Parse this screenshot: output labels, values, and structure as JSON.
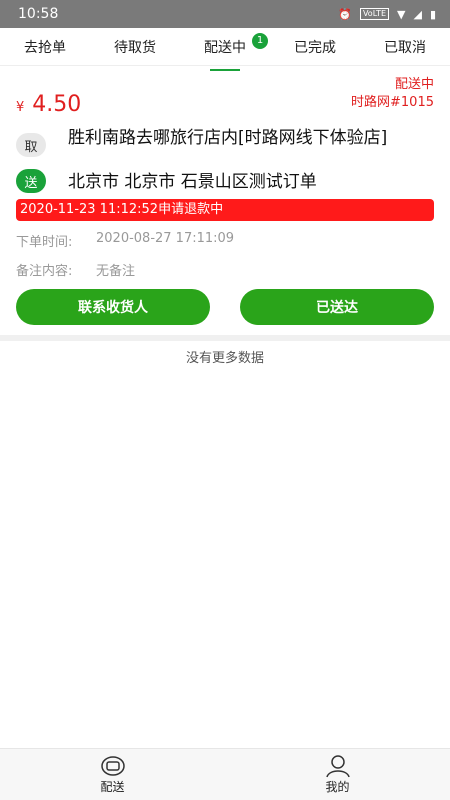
{
  "status_bar": {
    "time": "10:58",
    "alarm_icon": "alarm-icon",
    "lte": "VoLTE"
  },
  "tabs": [
    {
      "label": "去抢单"
    },
    {
      "label": "待取货"
    },
    {
      "label": "配送中",
      "badge": "1",
      "active": true
    },
    {
      "label": "已完成"
    },
    {
      "label": "已取消"
    }
  ],
  "order": {
    "currency": "¥",
    "price": "4.50",
    "status": "配送中",
    "order_code": "时路网#1015",
    "pickup_chip": "取",
    "pickup_address": "胜利南路去哪旅行店内[时路网线下体验店]",
    "delivery_chip": "送",
    "delivery_address": "北京市 北京市 石景山区测试订单",
    "refund_notice": "2020-11-23 11:12:52申请退款中",
    "order_time_label": "下单时间:",
    "order_time": "2020-08-27 17:11:09",
    "remark_label": "备注内容:",
    "remark": "无备注",
    "contact_button": "联系收货人",
    "delivered_button": "已送达"
  },
  "list_footer": "没有更多数据",
  "bottom_nav": [
    {
      "label": "配送",
      "icon": "delivery-icon"
    },
    {
      "label": "我的",
      "icon": "user-icon"
    }
  ],
  "colors": {
    "accent": "#1aa23a",
    "price": "#e01f1f",
    "refund": "#ff1a1a"
  }
}
